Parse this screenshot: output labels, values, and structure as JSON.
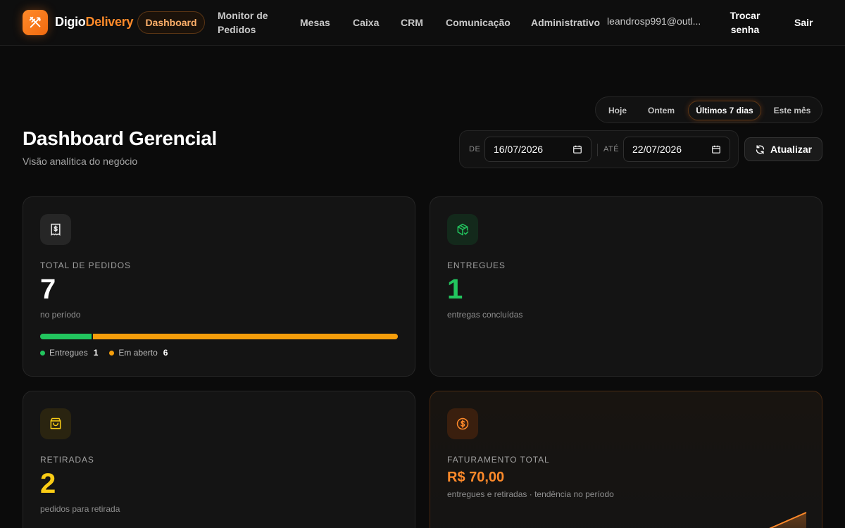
{
  "brand": {
    "name_part1": "Digio",
    "name_part2": "Delivery",
    "accent_color": "#ff8a2a"
  },
  "nav": {
    "dashboard": "Dashboard",
    "monitor_line1": "Monitor de",
    "monitor_line2": "Pedidos",
    "mesas": "Mesas",
    "caixa": "Caixa",
    "crm": "CRM",
    "comunicacao": "Comunicação",
    "administrativo": "Administrativo",
    "user_email": "leandrosp991@outl...",
    "trocar_line1": "Trocar",
    "trocar_line2": "senha",
    "sair": "Sair"
  },
  "header": {
    "title": "Dashboard Gerencial",
    "subtitle": "Visão analítica do negócio"
  },
  "period": {
    "options": [
      "Hoje",
      "Ontem",
      "Últimos 7 dias",
      "Este mês"
    ],
    "selected": "Últimos 7 dias"
  },
  "date_range": {
    "from_label": "DE",
    "from_value": "16/07/2026",
    "to_label": "ATÉ",
    "to_value": "22/07/2026",
    "refresh_label": "Atualizar"
  },
  "cards": {
    "total": {
      "label": "TOTAL DE PEDIDOS",
      "value": "7",
      "desc": "no período",
      "legend_delivered_label": "Entregues",
      "legend_delivered_value": "1",
      "legend_open_label": "Em aberto",
      "legend_open_value": "6",
      "delivered_count": 1,
      "open_count": 6,
      "delivered_color": "#22c55e",
      "open_color": "#f59e0b"
    },
    "entregues": {
      "label": "ENTREGUES",
      "value": "1",
      "desc": "entregas concluídas",
      "color": "#22c55e"
    },
    "retiradas": {
      "label": "RETIRADAS",
      "value": "2",
      "desc": "pedidos para retirada",
      "color": "#facc15"
    },
    "faturamento": {
      "label": "FATURAMENTO TOTAL",
      "value": "R$ 70,00",
      "desc": "entregues e retiradas · tendência no período",
      "color": "#ff8a2a"
    }
  }
}
